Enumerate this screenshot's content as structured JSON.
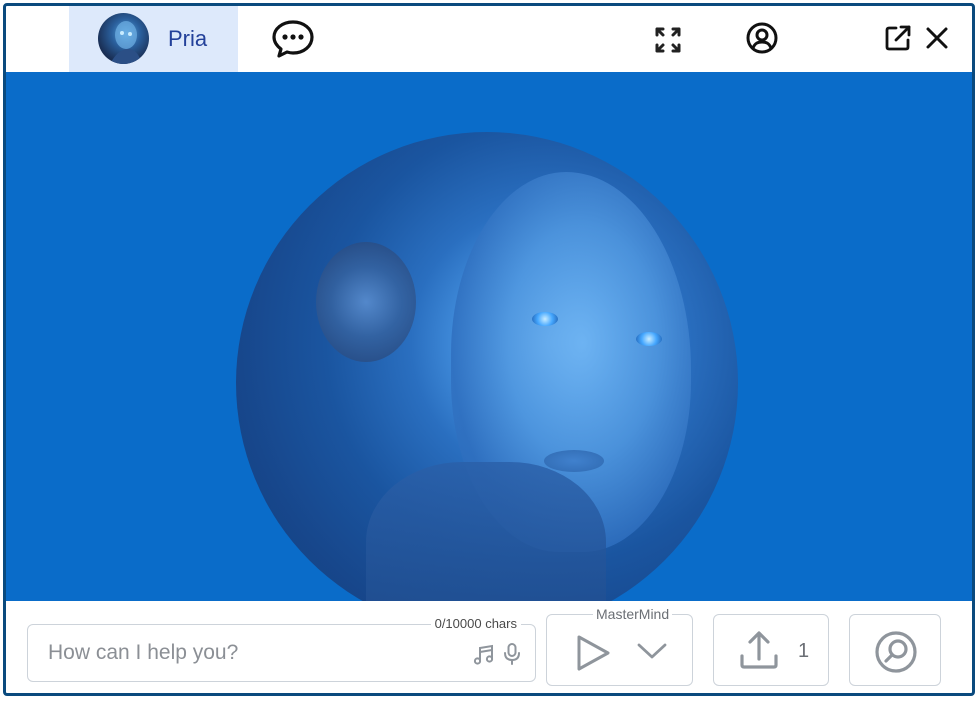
{
  "header": {
    "tab_label": "Pria",
    "avatar_icon": "pria-avatar",
    "chat_icon": "chat-bubble-icon",
    "expand_icon": "expand-icon",
    "account_icon": "account-icon",
    "popout_icon": "external-link-icon",
    "close_icon": "close-icon"
  },
  "composer": {
    "placeholder": "How can I help you?",
    "char_count": "0/10000 chars",
    "music_icon": "music-note-icon",
    "mic_icon": "microphone-icon"
  },
  "controls": {
    "mastermind_label": "MasterMind",
    "play_icon": "play-icon",
    "dropdown_icon": "chevron-down-icon",
    "upload_icon": "upload-icon",
    "upload_count": "1",
    "search_icon": "search-icon"
  },
  "colors": {
    "accent_blue": "#0a6cc9",
    "tab_bg": "#dde9fb",
    "tab_text": "#23419a",
    "icon_gray": "#8f959c"
  }
}
